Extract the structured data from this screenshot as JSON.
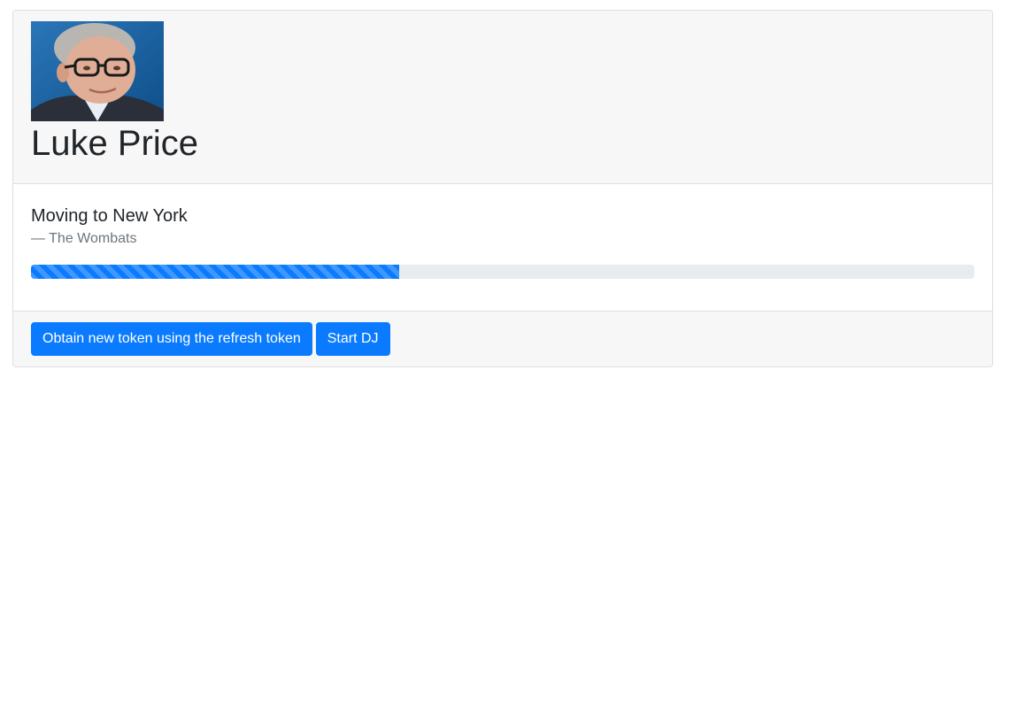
{
  "profile": {
    "avatar_icon": "profile-photo",
    "name": "Luke Price"
  },
  "now_playing": {
    "title": "Moving to New York",
    "artist": "— The Wombats",
    "progress_percent": 39
  },
  "actions": {
    "refresh_label": "Obtain new token using the refresh token",
    "start_dj_label": "Start DJ"
  },
  "colors": {
    "primary": "#0a7bff",
    "header_bg": "#f7f7f7",
    "progress_track": "#e9ecef",
    "muted_text": "#6c757d"
  }
}
